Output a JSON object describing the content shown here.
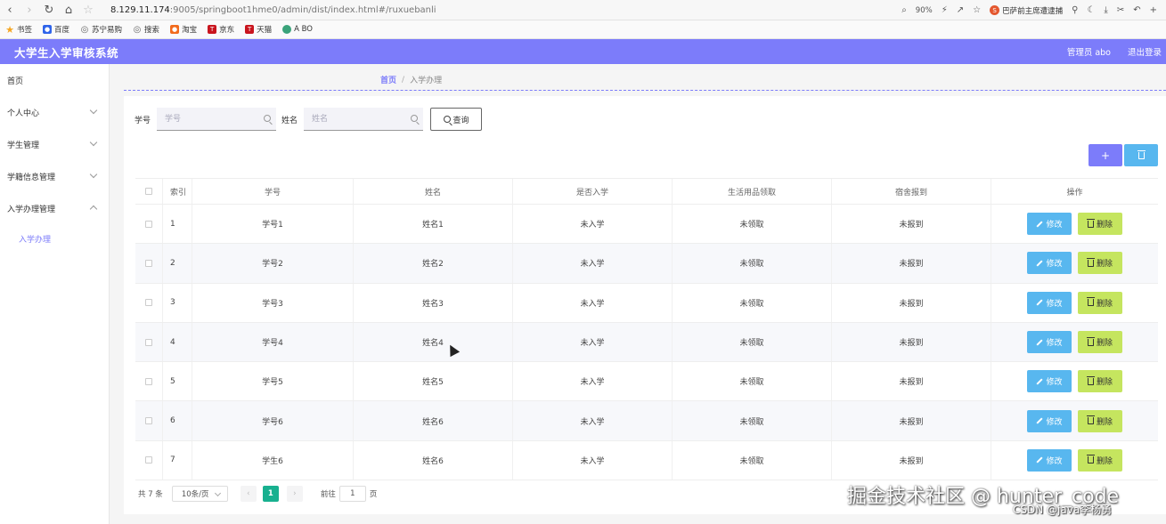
{
  "browser": {
    "url_host": "8.129.11.174",
    "url_path": ":9005/springboot1hme0/admin/dist/index.html#/ruxuebanli",
    "zoom": "90%",
    "promo_text": "巴萨前主席遭逮捕",
    "promo_logo": "S"
  },
  "bookmarks": [
    {
      "label": "书签",
      "icon": "star-icon",
      "color": "#f5a623"
    },
    {
      "label": "百度",
      "icon": "baidu-icon",
      "color": "#2f64ea"
    },
    {
      "label": "苏宁易购",
      "icon": "globe-icon",
      "color": "#666666"
    },
    {
      "label": "搜索",
      "icon": "globe-icon",
      "color": "#666666"
    },
    {
      "label": "淘宝",
      "icon": "taobao-icon",
      "color": "#f26b1d"
    },
    {
      "label": "京东",
      "icon": "jd-icon",
      "color": "#c9151e"
    },
    {
      "label": "天猫",
      "icon": "tmall-icon",
      "color": "#c9151e"
    },
    {
      "label": "A BO",
      "icon": "leaf-icon",
      "color": "#3aa37a"
    }
  ],
  "header": {
    "title": "大学生入学审核系统",
    "user": "管理员 abo",
    "logout": "退出登录"
  },
  "sidebar": {
    "items": [
      {
        "label": "首页"
      },
      {
        "label": "个人中心"
      },
      {
        "label": "学生管理"
      },
      {
        "label": "学籍信息管理"
      },
      {
        "label": "入学办理管理"
      }
    ],
    "sub_item": "入学办理"
  },
  "breadcrumb": {
    "home": "首页",
    "separator": "/",
    "current": "入学办理"
  },
  "search": {
    "no_label": "学号",
    "no_placeholder": "学号",
    "name_label": "姓名",
    "name_placeholder": "姓名",
    "query_label": "查询"
  },
  "actions": {
    "add_symbol": "+"
  },
  "table": {
    "headers": [
      "",
      "索引",
      "学号",
      "姓名",
      "是否入学",
      "生活用品领取",
      "宿舍报到",
      "操作"
    ],
    "edit_label": "修改",
    "delete_label": "删除",
    "rows": [
      {
        "idx": "1",
        "no": "学号1",
        "name": "姓名1",
        "enrolled": "未入学",
        "supplies": "未领取",
        "dorm": "未报到"
      },
      {
        "idx": "2",
        "no": "学号2",
        "name": "姓名2",
        "enrolled": "未入学",
        "supplies": "未领取",
        "dorm": "未报到"
      },
      {
        "idx": "3",
        "no": "学号3",
        "name": "姓名3",
        "enrolled": "未入学",
        "supplies": "未领取",
        "dorm": "未报到"
      },
      {
        "idx": "4",
        "no": "学号4",
        "name": "姓名4",
        "enrolled": "未入学",
        "supplies": "未领取",
        "dorm": "未报到"
      },
      {
        "idx": "5",
        "no": "学号5",
        "name": "姓名5",
        "enrolled": "未入学",
        "supplies": "未领取",
        "dorm": "未报到"
      },
      {
        "idx": "6",
        "no": "学号6",
        "name": "姓名6",
        "enrolled": "未入学",
        "supplies": "未领取",
        "dorm": "未报到"
      },
      {
        "idx": "7",
        "no": "学生6",
        "name": "姓名6",
        "enrolled": "未入学",
        "supplies": "未领取",
        "dorm": "未报到"
      }
    ]
  },
  "pagination": {
    "total": "共 7 条",
    "page_size": "10条/页",
    "current_page": "1",
    "goto_label": "前往",
    "goto_value": "1",
    "page_label": "页"
  },
  "watermark": {
    "main": "掘金技术社区 @ hunter_code",
    "sub": "CSDN @java李杨勇"
  },
  "colors": {
    "accent": "#7c7cfa",
    "edit": "#58b7ef",
    "delete": "#c5e55f",
    "pager_active": "#18b08f"
  }
}
